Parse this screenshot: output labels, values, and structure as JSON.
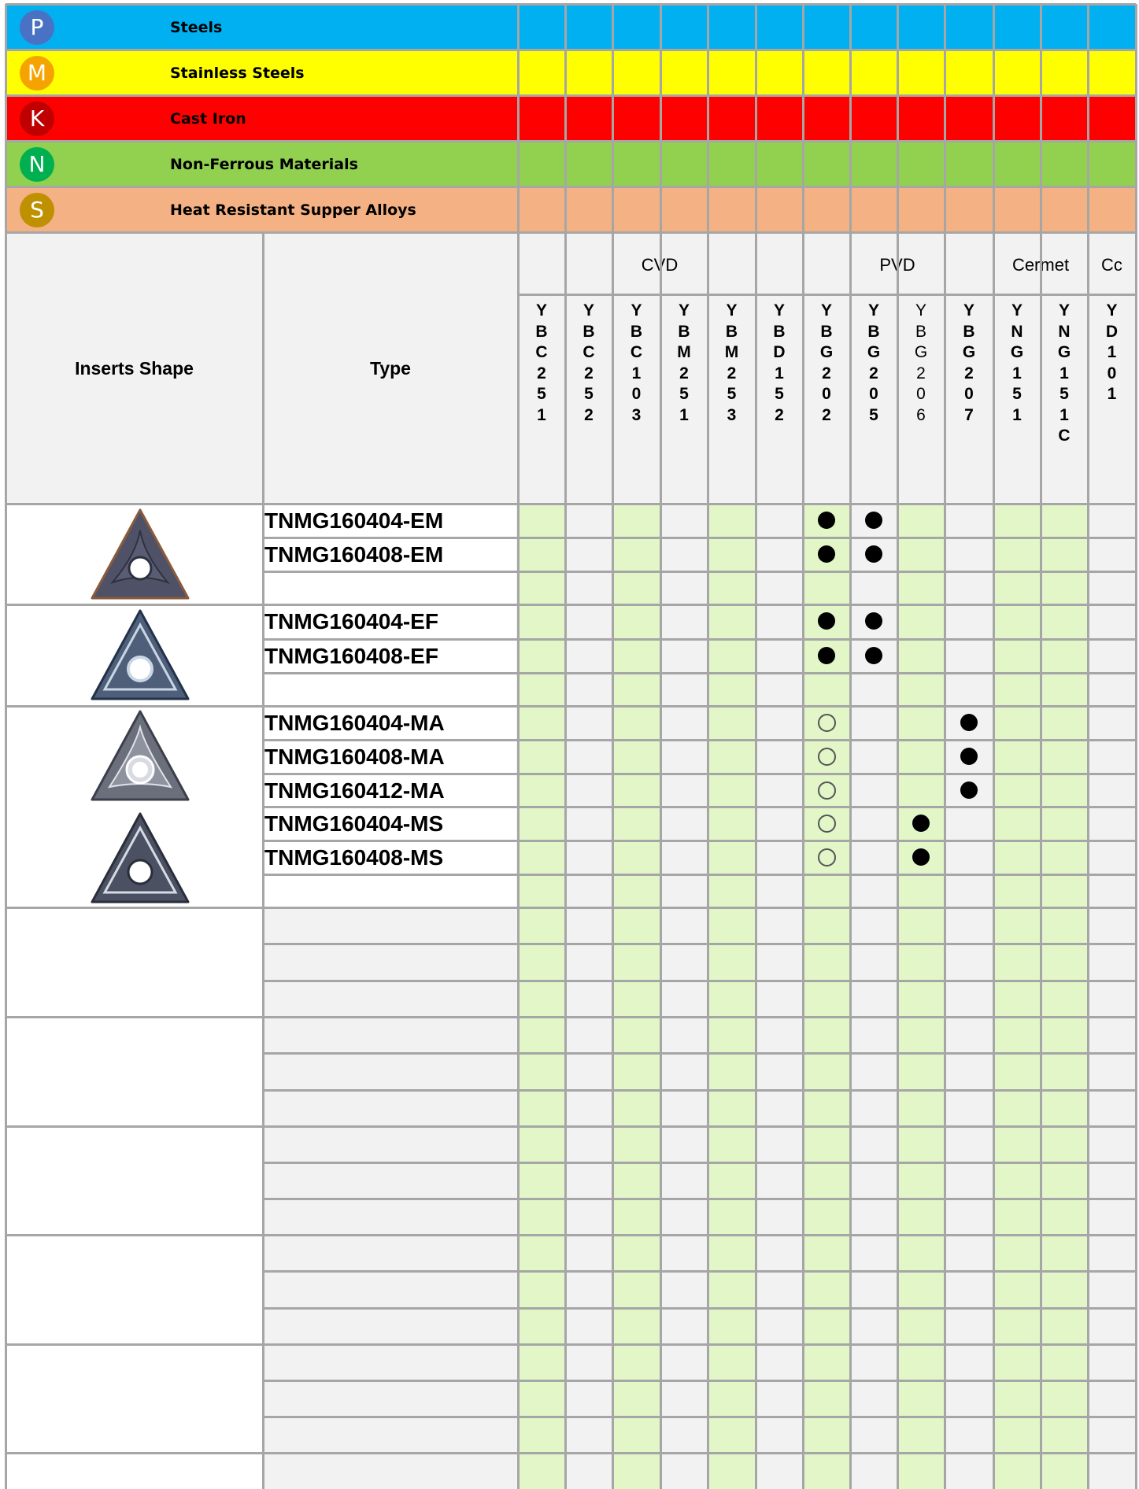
{
  "materials": [
    {
      "badge": "P",
      "label": "Steels",
      "band_color": "#00b0f0",
      "badge_color": "#4a72c4"
    },
    {
      "badge": "M",
      "label": "Stainless Steels",
      "band_color": "#ffff00",
      "badge_color": "#f5a300"
    },
    {
      "badge": "K",
      "label": "Cast Iron",
      "band_color": "#ff0000",
      "badge_color": "#c00000"
    },
    {
      "badge": "N",
      "label": "Non-Ferrous Materials",
      "band_color": "#92d050",
      "badge_color": "#00b050"
    },
    {
      "badge": "S",
      "label": "Heat Resistant Supper Alloys",
      "band_color": "#f4b183",
      "badge_color": "#bf9000"
    }
  ],
  "header": {
    "inserts_shape": "Inserts Shape",
    "type": "Type",
    "groups": [
      "CVD",
      "PVD",
      "Cermet",
      "Cc"
    ]
  },
  "grades": [
    {
      "name": "YBC251",
      "letters": "Y\nB\nC\n2\n5\n1"
    },
    {
      "name": "YBC252",
      "letters": "Y\nB\nC\n2\n5\n2"
    },
    {
      "name": "YBC103",
      "letters": "Y\nB\nC\n1\n0\n3"
    },
    {
      "name": "YBM251",
      "letters": "Y\nB\nM\n2\n5\n1"
    },
    {
      "name": "YBM253",
      "letters": "Y\nB\nM\n2\n5\n3"
    },
    {
      "name": "YBD152",
      "letters": "Y\nB\nD\n1\n5\n2"
    },
    {
      "name": "YBG202",
      "letters": "Y\nB\nG\n2\n0\n2"
    },
    {
      "name": "YBG205",
      "letters": "Y\nB\nG\n2\n0\n5"
    },
    {
      "name": "YBG206",
      "letters": "Y\nB\nG\n2\n0\n6"
    },
    {
      "name": "YBG207",
      "letters": "Y\nB\nG\n2\n0\n7"
    },
    {
      "name": "YNG151",
      "letters": "Y\nN\nG\n1\n5\n1"
    },
    {
      "name": "YNG151C",
      "letters": "Y\nN\nG\n1\n5\n1\nC"
    },
    {
      "name": "YD101",
      "letters": "Y\nD\n1\n0\n1"
    }
  ],
  "rows": [
    {
      "type": "TNMG160404-EM",
      "marks": {
        "YBG202": "●",
        "YBG205": "●"
      }
    },
    {
      "type": "TNMG160408-EM",
      "marks": {
        "YBG202": "●",
        "YBG205": "●"
      }
    },
    {
      "type": "",
      "marks": {}
    },
    {
      "type": "TNMG160404-EF",
      "marks": {
        "YBG202": "●",
        "YBG205": "●"
      }
    },
    {
      "type": "TNMG160408-EF",
      "marks": {
        "YBG202": "●",
        "YBG205": "●"
      }
    },
    {
      "type": "",
      "marks": {}
    },
    {
      "type": "TNMG160404-MA",
      "marks": {
        "YBG202": "○",
        "YBG207": "●"
      }
    },
    {
      "type": "TNMG160408-MA",
      "marks": {
        "YBG202": "○",
        "YBG207": "●"
      }
    },
    {
      "type": "TNMG160412-MA",
      "marks": {
        "YBG202": "○",
        "YBG207": "●"
      }
    },
    {
      "type": "TNMG160404-MS",
      "marks": {
        "YBG202": "○",
        "YBG206": "●"
      }
    },
    {
      "type": "TNMG160408-MS",
      "marks": {
        "YBG202": "○",
        "YBG206": "●"
      }
    },
    {
      "type": "",
      "marks": {}
    }
  ],
  "colors": {
    "grid": "#a6a6a6",
    "header_bg": "#f2f2f2",
    "light_green": "#e2f6c8",
    "insert_fill": "#4f5266"
  }
}
